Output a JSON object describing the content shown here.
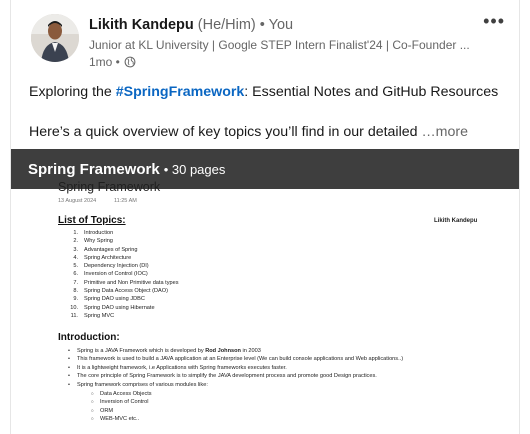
{
  "post": {
    "author": {
      "name": "Likith Kandepu",
      "pronouns": "(He/Him)",
      "degree": "• You",
      "headline": "Junior at KL University | Google STEP Intern Finalist'24 | Co-Founder ...",
      "time": "1mo •",
      "visibility_icon": "globe-icon"
    },
    "menu_label": "•••",
    "text_prefix": "Exploring the ",
    "hashtag": "#SpringFramework",
    "text_suffix": ": Essential Notes and GitHub Resources",
    "text_line2": "Here’s a quick overview of key topics you’ll find in our detailed ",
    "see_more": "…more"
  },
  "document": {
    "title": "Spring Framework",
    "pages": "• 30 pages",
    "page1": {
      "title": "Spring Framework",
      "date": "13 August 2024",
      "time": "11:25 AM",
      "author": "Likith Kandepu",
      "toc_heading": "List of Topics:",
      "toc": [
        {
          "n": "1.",
          "t": "Introduction"
        },
        {
          "n": "2.",
          "t": "Why Spring"
        },
        {
          "n": "3.",
          "t": "Advantages of Spring"
        },
        {
          "n": "4.",
          "t": "Spring Architecture"
        },
        {
          "n": "5.",
          "t": "Dependency Injection (DI)"
        },
        {
          "n": "6.",
          "t": "Inversion of Control (IOC)"
        },
        {
          "n": "7.",
          "t": "Primitive and Non Primitive data types"
        },
        {
          "n": "8.",
          "t": "Spring Data Access Object (DAO)"
        },
        {
          "n": "9.",
          "t": "Spring DAO using JDBC"
        },
        {
          "n": "10.",
          "t": "Spring DAO using Hibernate"
        },
        {
          "n": "11.",
          "t": "Spring MVC"
        }
      ],
      "intro_heading": "Introduction:",
      "intro": [
        {
          "pre": "Spring is a JAVA Framework which is developed by ",
          "bold": "Rod Johnson",
          "post": " in 2003"
        },
        {
          "pre": "This framework is used to build a JAVA application at an Enterprise level (We can build console applications and Web applications..)",
          "bold": "",
          "post": ""
        },
        {
          "pre": "It is a lightweight framework, i.e Applications with Spring frameworks executes faster.",
          "bold": "",
          "post": ""
        },
        {
          "pre": "The core principle of Spring Framework is to simplify the JAVA development process and promote good Design practices.",
          "bold": "",
          "post": ""
        },
        {
          "pre": "Spring framework comprises of various modules like:",
          "bold": "",
          "post": ""
        }
      ],
      "modules": [
        "Data Access Objects",
        "Inversion of Control",
        "ORM",
        "WEB-MVC etc.."
      ]
    }
  },
  "colors": {
    "hashtag": "#0a66c2",
    "doc_bar": "#1e1e1e"
  }
}
